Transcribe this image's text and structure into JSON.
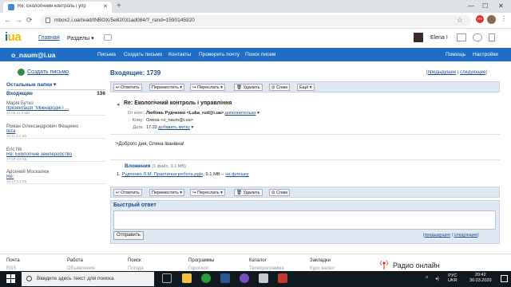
{
  "browser": {
    "tab_title": "Re: Екологічний контроль і упр",
    "url": "mbox2.i.ua/read/INBOX/5e82031ad084/?_rand=1590145920"
  },
  "site": {
    "logo_main": "i",
    "logo_ua": "ua",
    "nav_main": "Главная",
    "nav_sections": "Разделы",
    "user_name": "Elena I"
  },
  "bluebar": {
    "email": "o_naum@i.ua",
    "links": [
      "Письма",
      "Создать письмо",
      "Контакты",
      "Проверить почту",
      "Поиск писем"
    ],
    "help": "Помощь",
    "settings": "Настройки"
  },
  "sidebar": {
    "create_mail": "Создать письмо",
    "other_folders": "Остальные папки",
    "inbox_label": "Входящие",
    "inbox_count": "136",
    "messages": [
      {
        "from": "Марія Бутко",
        "subject": "презентація \"Міжнародні і ...",
        "time": "20:39 21.8 МБ"
      },
      {
        "from": "Роман Олександрович Фещенко",
        "subject": "teza",
        "time": "20:11 3.4 КБ"
      },
      {
        "from": "Eric Nk",
        "subject": "Re: Екологічне землеробство",
        "time": "17:30 4.9 КБ"
      },
      {
        "from": "Арсений Москалюк",
        "subject": "Re:",
        "time": "16:13 5.3 КБ"
      }
    ]
  },
  "main": {
    "folder_title": "Входящие: 1739",
    "pager_prev": "предыдущее",
    "pager_next": "следующее",
    "toolbar": [
      "Ответить",
      "Переместить",
      "Переслать",
      "Удалить",
      "Спам",
      "Ещё"
    ],
    "subject": "Re: Екологічний контроль і управління",
    "from_label": "От кого:",
    "from_value": "Любовь Рудченко <Luba_rud@i.ua>",
    "from_more": "дополнительно",
    "to_label": "Кому:",
    "to_value": "Олена <o_naum@i.ua>",
    "date_label": "Дата:",
    "date_value": "17:32",
    "date_action": "добавить метку",
    "body": ">Доброго дня, Олена Іванівна!",
    "attach_title": "Вложения",
    "attach_summary": "(1 файл, 9.1 MB)",
    "attach_index": "1.",
    "attach_file": "Рудченко Л.М. Практична робота.pptx",
    "attach_size": ", 9.1 MB –",
    "attach_flash": "на флешку"
  },
  "quick_reply": {
    "title": "Быстрый ответ",
    "send": "Отправить",
    "pager_prev": "предыдущее",
    "pager_next": "следующее"
  },
  "footer": {
    "col1": [
      "Почта",
      "RSS"
    ],
    "col2": [
      "Работа",
      "Объявления"
    ],
    "col3": [
      "Поиск",
      "Погода"
    ],
    "col4": [
      "Программы",
      "Гороскоп"
    ],
    "col5": [
      "Каталог",
      "Телепрограмма"
    ],
    "col6": [
      "Закладки",
      "Курс валют"
    ],
    "radio": "Радио онлайн"
  },
  "taskbar": {
    "search_placeholder": "Введите здесь текст для поиска",
    "lang1": "РУС",
    "lang2": "UKR",
    "time": "20:42",
    "date": "30.03.2020"
  }
}
